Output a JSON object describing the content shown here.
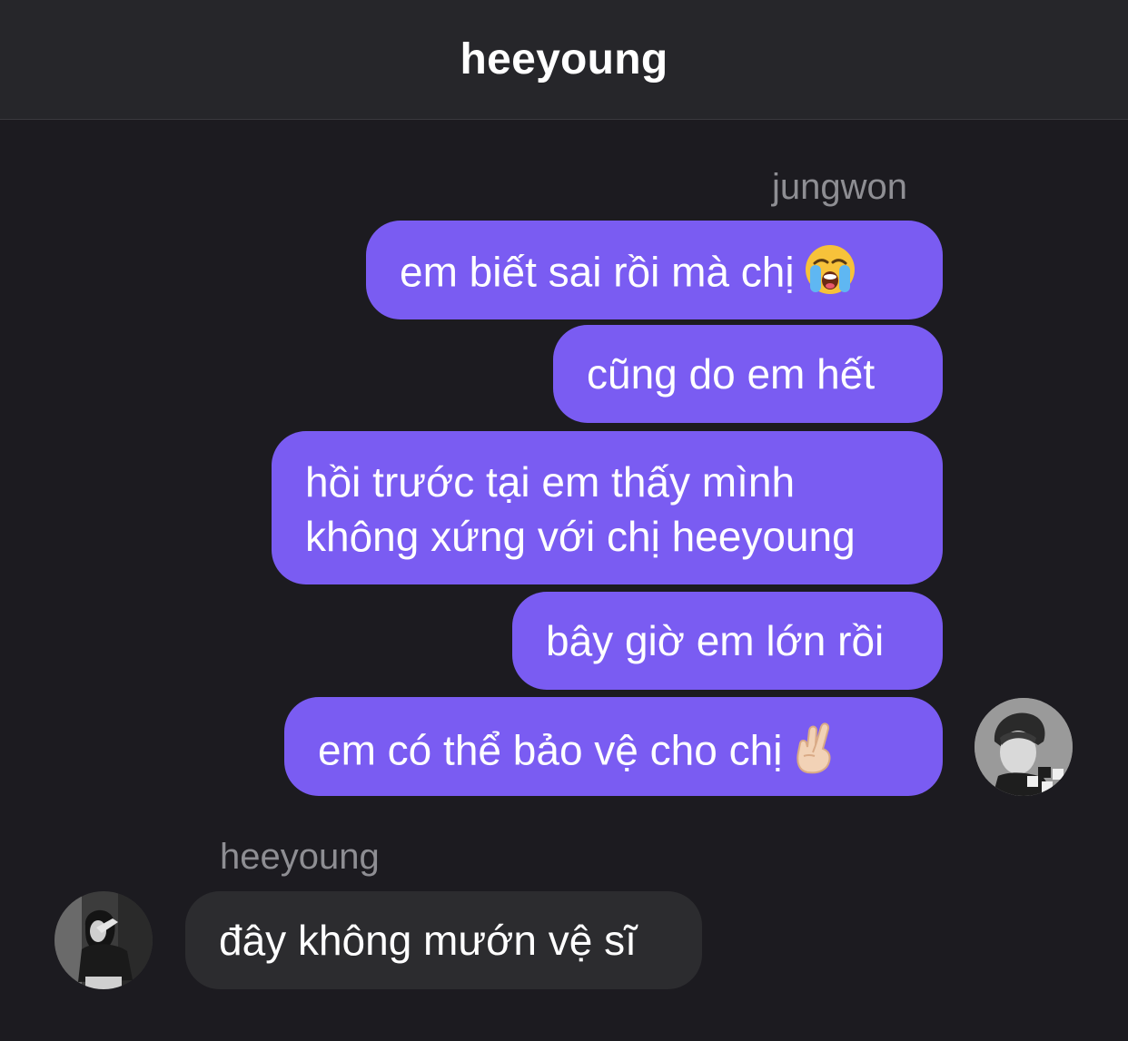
{
  "header": {
    "title": "heeyoung"
  },
  "outgoing": {
    "sender": "jungwon",
    "messages": [
      {
        "text": "em biết sai rồi mà chị",
        "emoji": "loudly-crying-face-icon"
      },
      {
        "text": "cũng do em hết"
      },
      {
        "line1": "hồi trước tại em thấy mình",
        "line2": "không xứng với chị heeyoung"
      },
      {
        "text": "bây giờ em lớn rồi"
      },
      {
        "text": "em có thể bảo vệ cho chị",
        "emoji": "hand-with-index-and-middle-fingers-crossed-icon"
      }
    ]
  },
  "incoming": {
    "sender": "heeyoung",
    "messages": [
      {
        "text": "đây không mướn vệ sĩ"
      }
    ]
  },
  "colors": {
    "background": "#1c1b20",
    "header": "#26262a",
    "outgoing_bubble": "#7a5cf2",
    "incoming_bubble": "#2c2c2f",
    "sender_label": "#8e8e93"
  }
}
